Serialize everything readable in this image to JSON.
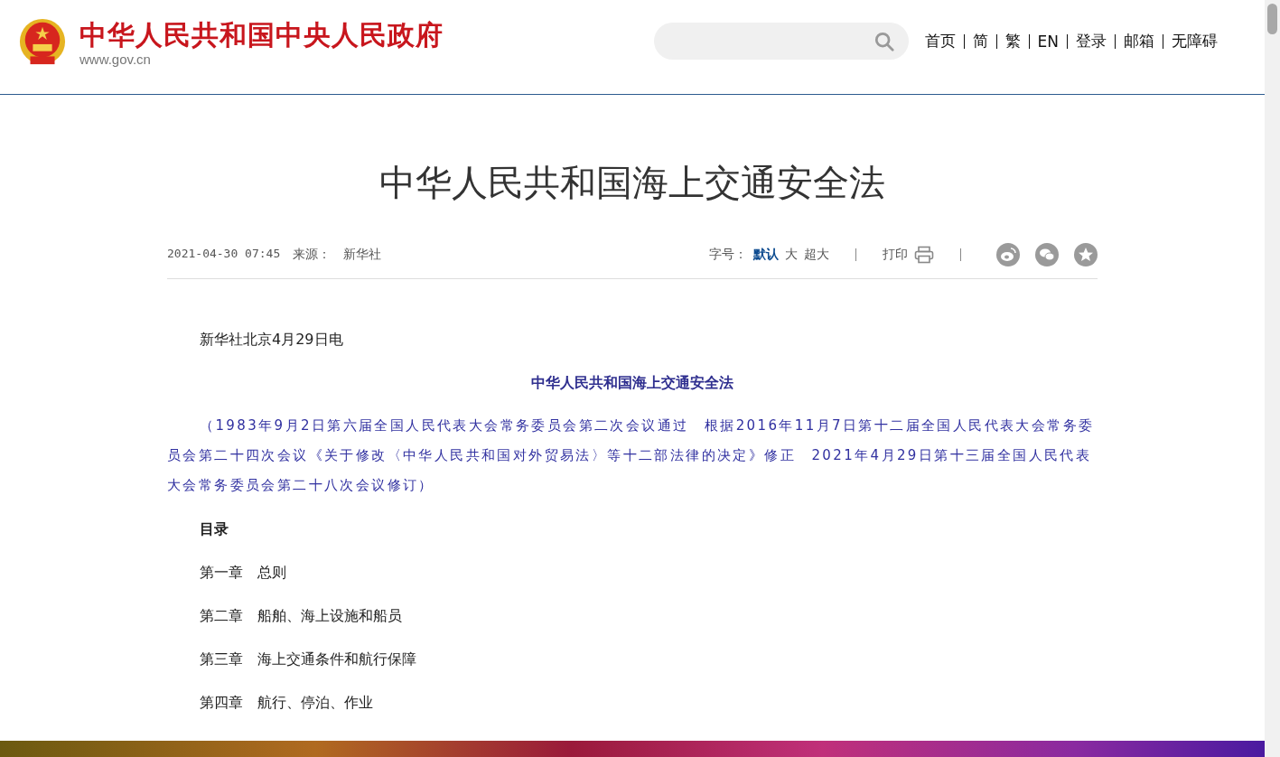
{
  "header": {
    "site_name": "中华人民共和国中央人民政府",
    "site_url": "www.gov.cn",
    "nav": [
      "首页",
      "简",
      "繁",
      "EN",
      "登录",
      "邮箱",
      "无障碍"
    ]
  },
  "article": {
    "title": "中华人民共和国海上交通安全法",
    "date": "2021-04-30 07:45",
    "source_label": "来源：",
    "source": "新华社",
    "font_size_label": "字号：",
    "font_sizes": [
      {
        "label": "默认",
        "selected": true
      },
      {
        "label": "大",
        "selected": false
      },
      {
        "label": "超大",
        "selected": false
      }
    ],
    "print_label": "打印",
    "paragraphs": [
      {
        "kind": "plain",
        "text": "新华社北京4月29日电"
      },
      {
        "kind": "heading",
        "text": "中华人民共和国海上交通安全法"
      },
      {
        "kind": "note",
        "text": "（1983年9月2日第六届全国人民代表大会常务委员会第二次会议通过　根据2016年11月7日第十二届全国人民代表大会常务委员会第二十四次会议《关于修改〈中华人民共和国对外贸易法〉等十二部法律的决定》修正　2021年4月29日第十三届全国人民代表大会常务委员会第二十八次会议修订）"
      },
      {
        "kind": "bold",
        "text": "目录"
      },
      {
        "kind": "plain",
        "text": "第一章　总则"
      },
      {
        "kind": "plain",
        "text": "第二章　船舶、海上设施和船员"
      },
      {
        "kind": "plain",
        "text": "第三章　海上交通条件和航行保障"
      },
      {
        "kind": "plain",
        "text": "第四章　航行、停泊、作业"
      }
    ]
  }
}
